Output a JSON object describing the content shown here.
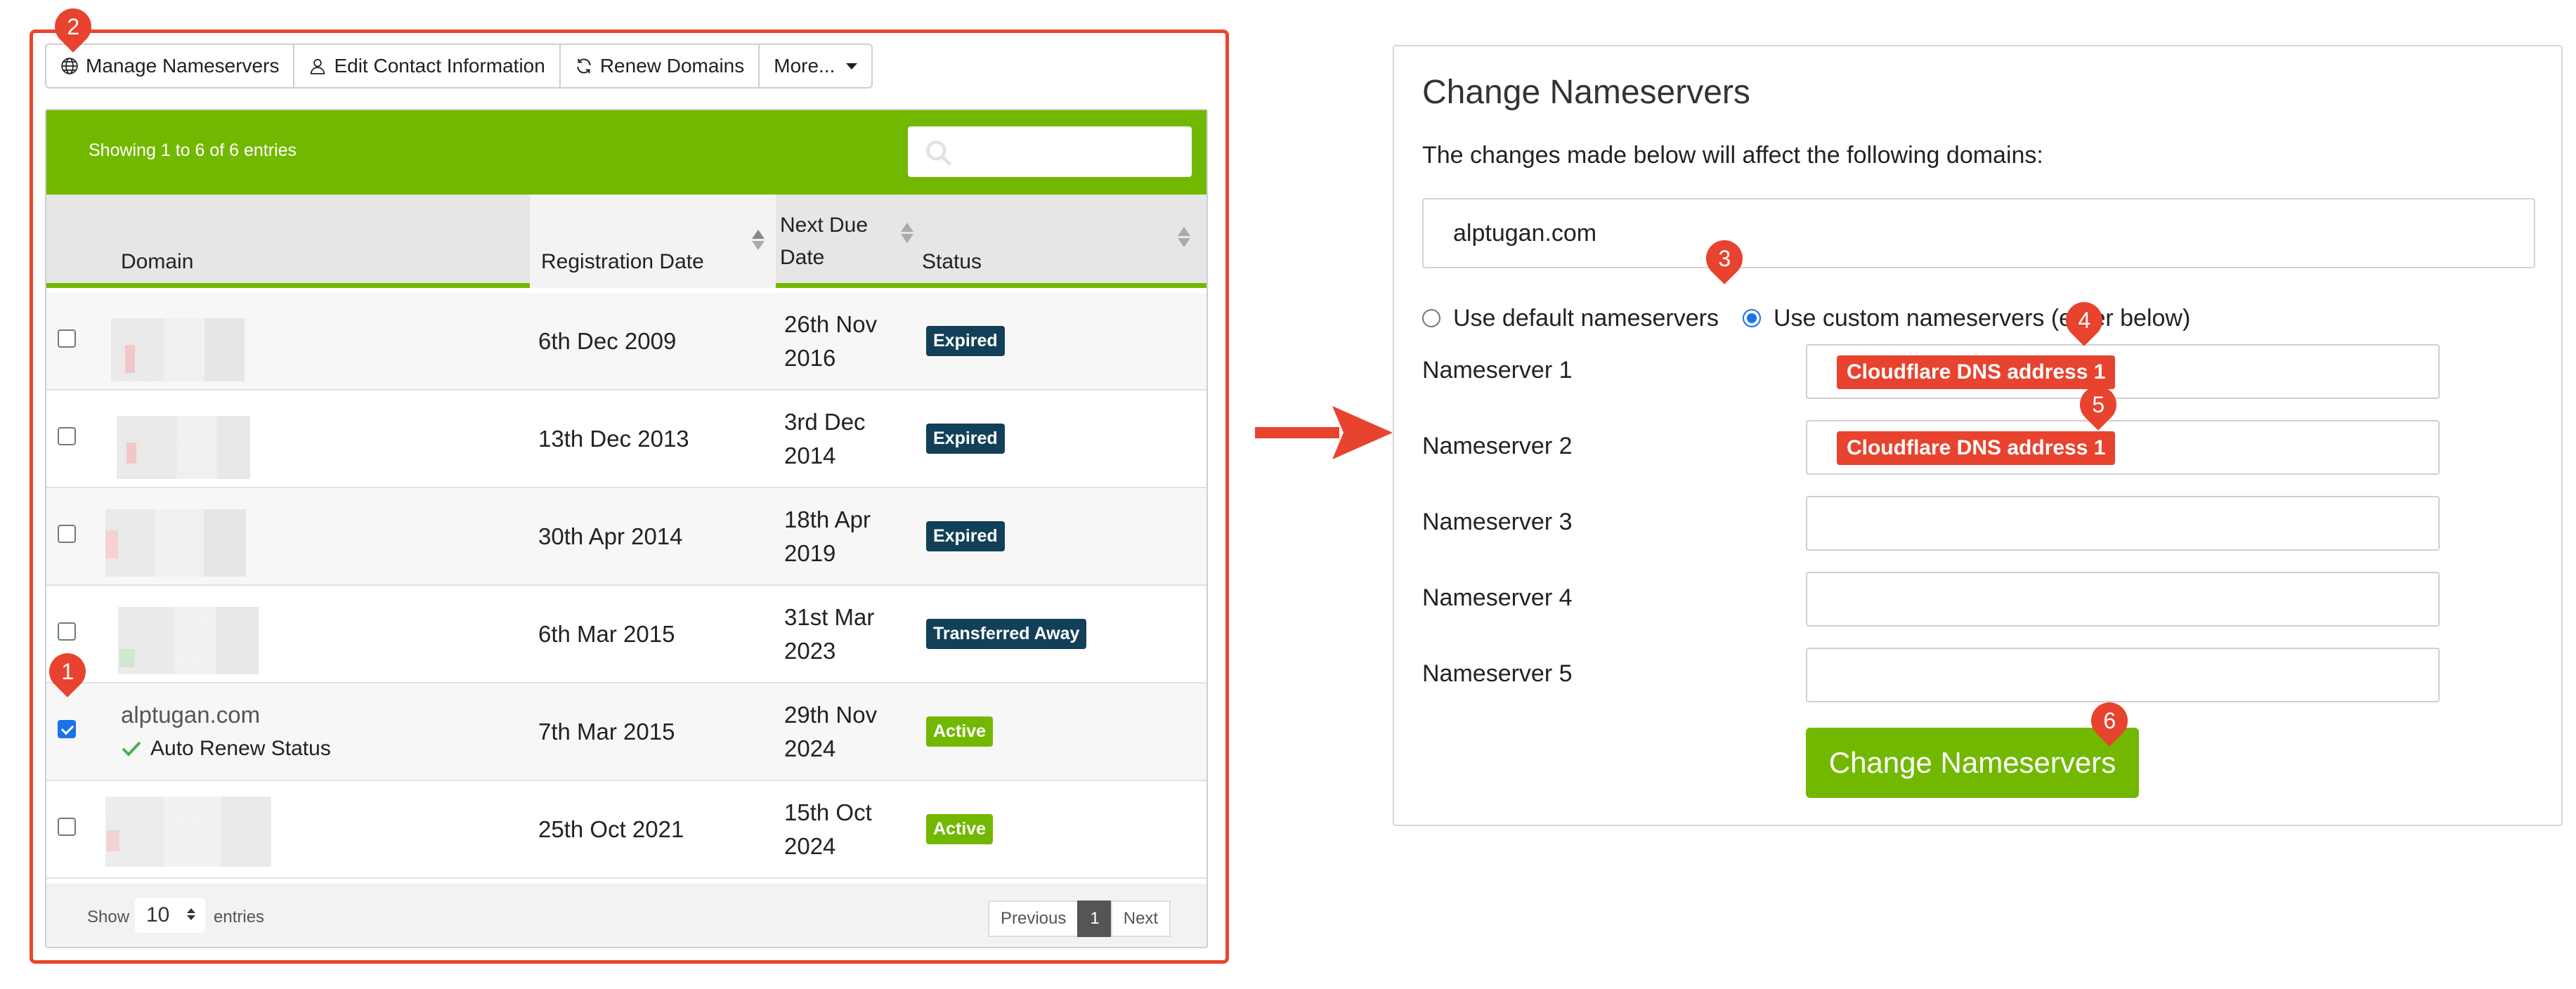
{
  "toolbar": {
    "manage_nameservers": "Manage Nameservers",
    "edit_contact": "Edit Contact Information",
    "renew_domains": "Renew Domains",
    "more": "More..."
  },
  "table": {
    "info": "Showing 1 to 6 of 6 entries",
    "columns": [
      "Domain",
      "Registration Date",
      "Next Due Date",
      "Status"
    ],
    "rows": [
      {
        "domain": "",
        "sub": "",
        "reg": "6th Dec 2009",
        "due1": "26th Nov",
        "due2": "2016",
        "status": "Expired",
        "checked": false
      },
      {
        "domain": "",
        "sub": "",
        "reg": "13th Dec 2013",
        "due1": "3rd Dec",
        "due2": "2014",
        "status": "Expired",
        "checked": false
      },
      {
        "domain": "",
        "sub": "",
        "reg": "30th Apr 2014",
        "due1": "18th Apr",
        "due2": "2019",
        "status": "Expired",
        "checked": false
      },
      {
        "domain": "",
        "sub": "",
        "reg": "6th Mar 2015",
        "due1": "31st Mar",
        "due2": "2023",
        "status": "Transferred Away",
        "checked": false
      },
      {
        "domain": "alptugan.com",
        "sub": "Auto Renew Status",
        "reg": "7th Mar 2015",
        "due1": "29th Nov",
        "due2": "2024",
        "status": "Active",
        "checked": true
      },
      {
        "domain": "",
        "sub": "",
        "reg": "25th Oct 2021",
        "due1": "15th Oct",
        "due2": "2024",
        "status": "Active",
        "checked": false
      }
    ],
    "footer": {
      "show": "Show",
      "page_size": "10",
      "entries": "entries",
      "prev": "Previous",
      "page": "1",
      "next": "Next"
    }
  },
  "panel": {
    "title": "Change Nameservers",
    "description": "The changes made below will affect the following domains:",
    "domain": "alptugan.com",
    "radio_default": "Use default nameservers",
    "radio_custom": "Use custom nameservers (enter below)",
    "ns_labels": [
      "Nameserver 1",
      "Nameserver 2",
      "Nameserver 3",
      "Nameserver 4",
      "Nameserver 5"
    ],
    "ns_tags": [
      "Cloudflare DNS address 1",
      "Cloudflare DNS address 1"
    ],
    "submit": "Change Nameservers"
  },
  "markers": [
    "1",
    "2",
    "3",
    "4",
    "5",
    "6"
  ],
  "colors": {
    "accent_green": "#73b800",
    "marker_red": "#e8432e",
    "badge_dark": "#124058",
    "checkbox_blue": "#1a73e8"
  }
}
